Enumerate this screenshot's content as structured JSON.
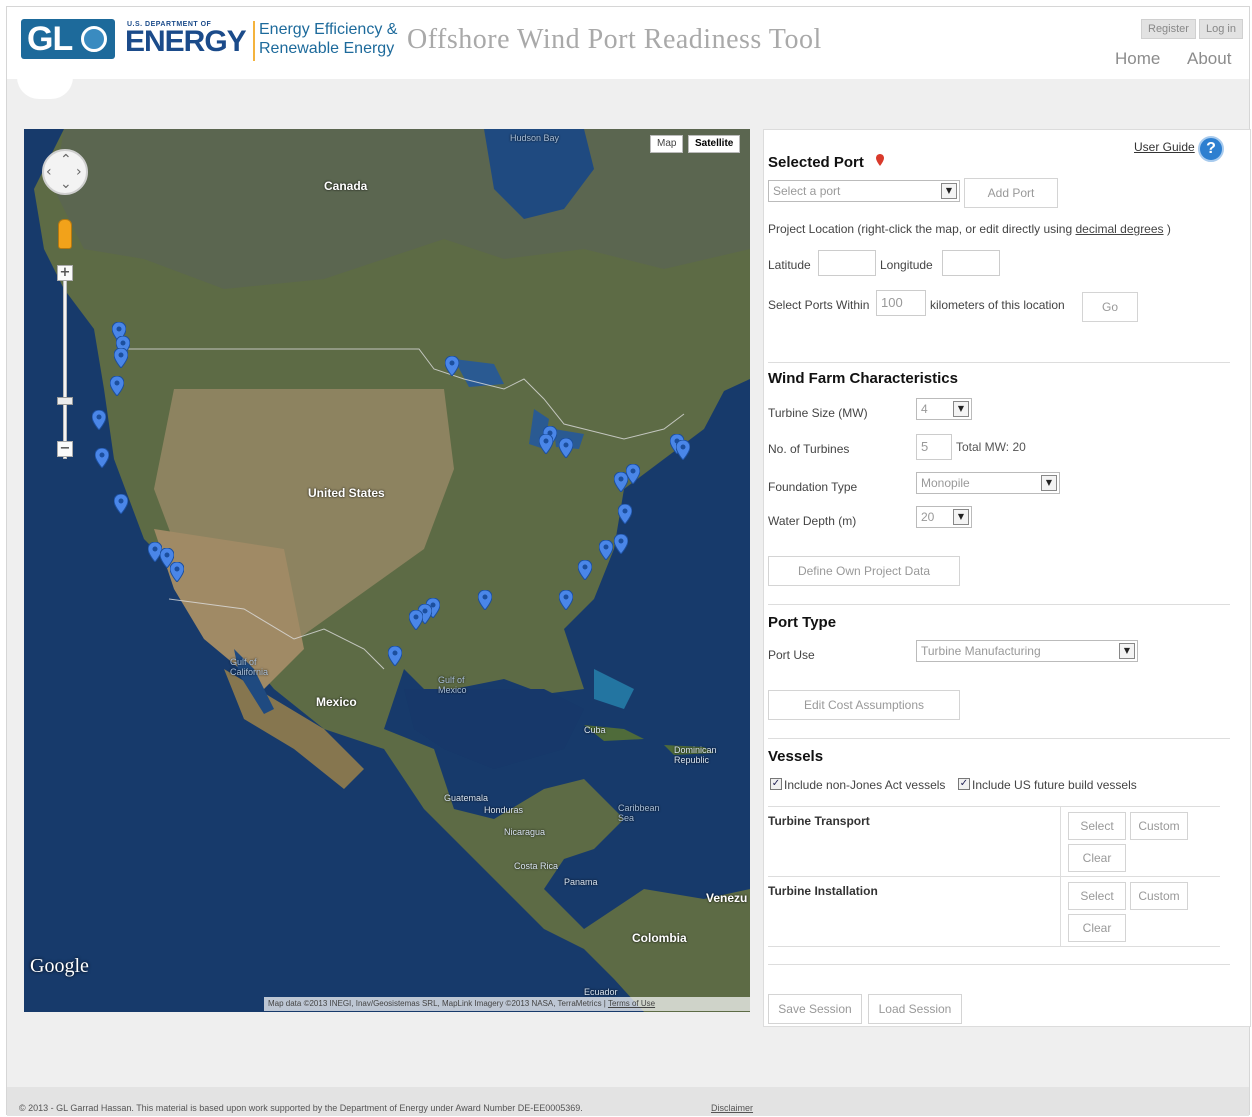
{
  "header": {
    "logo_gl": "GL",
    "doe_small": "U.S. DEPARTMENT OF",
    "doe_big": "ENERGY",
    "eere_line1": "Energy Efficiency &",
    "eere_line2": "Renewable Energy",
    "app_title": "Offshore Wind Port Readiness Tool",
    "register": "Register",
    "login": "Log in",
    "nav": {
      "home": "Home",
      "about": "About"
    }
  },
  "map": {
    "type_buttons": {
      "map": "Map",
      "satellite": "Satellite"
    },
    "active_type": "Satellite",
    "labels": {
      "canada": "Canada",
      "united_states": "United States",
      "mexico": "Mexico",
      "hudson_bay": "Hudson Bay",
      "gulf_mexico": "Gulf of Mexico",
      "gulf_california": "Gulf of California",
      "cuba": "Cuba",
      "dominican": "Dominican Republic",
      "guatemala": "Guatemala",
      "honduras": "Honduras",
      "nicaragua": "Nicaragua",
      "costa_rica": "Costa Rica",
      "panama": "Panama",
      "caribbean": "Caribbean Sea",
      "venezuela": "Venezu",
      "colombia": "Colombia",
      "ecuador": "Ecuador"
    },
    "google": "Google",
    "attribution": "Map data ©2013 INEGI, Inav/Geosistemas SRL, MapLink Imagery ©2013 NASA, TerraMetrics",
    "terms": "Terms of Use",
    "zoom_in": "+",
    "zoom_out": "−",
    "port_marker_count": 32,
    "colors": {
      "pin": "#4a86e8",
      "water": "#173a6b",
      "land": "#5c6b45"
    }
  },
  "panel": {
    "user_guide": "User Guide",
    "help": "?",
    "selected_port": {
      "title": "Selected Port",
      "select_placeholder": "Select a port",
      "add_port": "Add Port",
      "location_note_pre": "Project Location (right-click the map, or edit directly using",
      "location_link": "decimal degrees",
      "location_note_post": ")",
      "latitude_label": "Latitude",
      "latitude_value": "",
      "longitude_label": "Longitude",
      "longitude_value": "",
      "within_label": "Select Ports Within",
      "within_value": "100",
      "km_label": "kilometers of this location",
      "go": "Go"
    },
    "wind_farm": {
      "title": "Wind Farm Characteristics",
      "turbine_size_label": "Turbine Size (MW)",
      "turbine_size_value": "4",
      "num_turbines_label": "No. of Turbines",
      "num_turbines_value": "5",
      "total_mw": "Total MW: 20",
      "foundation_label": "Foundation Type",
      "foundation_value": "Monopile",
      "depth_label": "Water Depth (m)",
      "depth_value": "20",
      "define_button": "Define Own Project Data"
    },
    "port_type": {
      "title": "Port Type",
      "use_label": "Port Use",
      "use_value": "Turbine Manufacturing",
      "edit_button": "Edit Cost Assumptions"
    },
    "vessels": {
      "title": "Vessels",
      "include_non_jones": "Include non-Jones Act vessels",
      "include_non_jones_checked": true,
      "include_future": "Include US future build vessels",
      "include_future_checked": true,
      "transport_label": "Turbine Transport",
      "installation_label": "Turbine Installation",
      "select": "Select",
      "custom": "Custom",
      "clear": "Clear"
    },
    "session": {
      "save": "Save Session",
      "load": "Load Session"
    }
  },
  "footer": {
    "text": "© 2013 - GL Garrad Hassan.    This material is based upon work supported by the Department of Energy under Award Number DE-EE0005369.",
    "disclaimer": "Disclaimer"
  }
}
